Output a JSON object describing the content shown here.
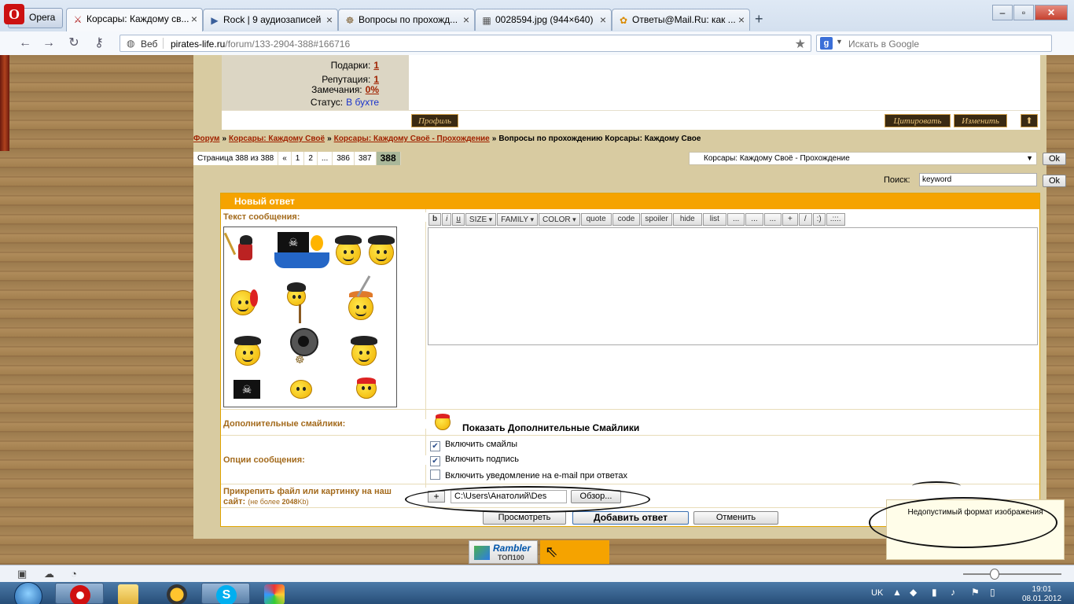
{
  "browser": {
    "opera_label": "Opera",
    "tabs": [
      {
        "label": "Корсары: Каждому св...",
        "icon": "sword-icon",
        "active": true
      },
      {
        "label": "Rock | 9 аудиозаписей",
        "icon": "play-icon"
      },
      {
        "label": "Вопросы по прохожд...",
        "icon": "wheel-icon"
      },
      {
        "label": "0028594.jpg (944×640)",
        "icon": "image-icon"
      },
      {
        "label": "Ответы@Mail.Ru: как ...",
        "icon": "mailru-icon"
      }
    ],
    "new_tab": "+",
    "address": {
      "badge": "Веб",
      "host": "pirates-life.ru",
      "path": "/forum/133-2904-388#166716"
    },
    "search": {
      "engine_letter": "g",
      "placeholder": "Искать в Google"
    }
  },
  "page": {
    "user": {
      "gifts_label": "Подарки:",
      "gifts_value": "1",
      "rep_label": "Репутация:",
      "rep_value": "1",
      "warn_label": "Замечания:",
      "warn_value": "0%",
      "status_label": "Статус:",
      "status_value": "В бухте"
    },
    "post_buttons": {
      "profile": "Профиль",
      "quote": "Цитировать",
      "edit": "Изменить",
      "up": "⬆"
    },
    "breadcrumb": {
      "forum": "Форум",
      "cat": "Корсары: Каждому Своё",
      "sub": "Корсары: Каждому Своё - Прохождение",
      "current": "Вопросы по прохождению Корсары: Каждому Свое",
      "sep": "»"
    },
    "pager": {
      "label": "Страница 388 из 388",
      "items": [
        "«",
        "1",
        "2",
        "...",
        "386",
        "387"
      ],
      "current": "388"
    },
    "forum_select": "Корсары: Каждому Своё - Прохождение",
    "ok": "Ok",
    "search_label": "Поиск:",
    "search_value": "keyword"
  },
  "reply": {
    "header": "Новый ответ",
    "text_label": "Текст сообщения:",
    "toolbar": [
      "b",
      "i",
      "u",
      "SIZE",
      "FAMILY",
      "COLOR",
      "quote",
      "code",
      "spoiler",
      "hide",
      "list",
      "...",
      "...",
      "...",
      "+",
      "/",
      ":)",
      ".:::."
    ],
    "extra_smiles_label": "Дополнительные смайлики:",
    "show_extra": "Показать Дополнительные Смайлики",
    "options_label": "Опции сообщения:",
    "options": [
      {
        "label": "Включить смайлы",
        "checked": true
      },
      {
        "label": "Включить подпись",
        "checked": true
      },
      {
        "label": "Включить уведомление на e-mail при ответах",
        "checked": false
      }
    ],
    "attach_label_1": "Прикрепить файл или картинку на наш",
    "attach_label_2": "сайт:",
    "attach_note_pre": "(не более ",
    "attach_note_size": "2048",
    "attach_note_post": "Kb)",
    "plus": "+",
    "file_value": "C:\\Users\\Анатолий\\Des",
    "browse": "Обзор...",
    "preview": "Просмотреть",
    "submit": "Добавить ответ",
    "cancel": "Отменить"
  },
  "tooltip": "Недопустимый формат изображения",
  "rambler": {
    "name": "Rambler",
    "top": "ТОП100"
  },
  "taskbar": {
    "lang": "UK",
    "time": "19:01",
    "date": "08.01.2012"
  }
}
